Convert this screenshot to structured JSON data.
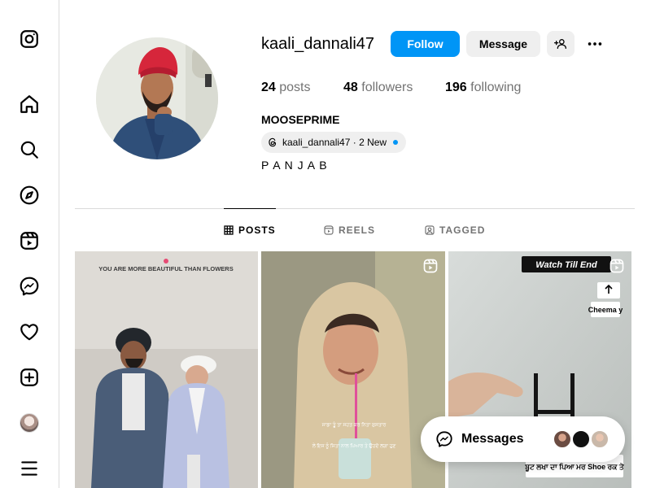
{
  "sidebar": {
    "items": [
      {
        "name": "instagram-logo-icon"
      },
      {
        "name": "home-icon"
      },
      {
        "name": "search-icon"
      },
      {
        "name": "explore-icon"
      },
      {
        "name": "reels-icon"
      },
      {
        "name": "messenger-icon"
      },
      {
        "name": "notifications-heart-icon"
      },
      {
        "name": "create-icon"
      },
      {
        "name": "profile-avatar"
      },
      {
        "name": "menu-icon"
      }
    ]
  },
  "profile": {
    "username": "kaali_dannali47",
    "follow_label": "Follow",
    "message_label": "Message",
    "stats": {
      "posts_count": "24",
      "posts_label": "posts",
      "followers_count": "48",
      "followers_label": "followers",
      "following_count": "196",
      "following_label": "following"
    },
    "full_name": "MOOSEPRIME",
    "threads_badge": "kaali_dannali47 · 2 New",
    "bio": "P A N J A B"
  },
  "tabs": [
    {
      "label": "POSTS",
      "active": true
    },
    {
      "label": "REELS",
      "active": false
    },
    {
      "label": "TAGGED",
      "active": false
    }
  ],
  "posts": [
    {
      "caption": "YOU ARE MORE BEAUTIFUL THAN FLOWERS",
      "is_reel": false
    },
    {
      "caption": "",
      "is_reel": true
    },
    {
      "caption": "Watch Till End",
      "sticker": "Cheema y",
      "bottom_text": "ਬੂਟ ਲਖਾ ਦਾ ਪਿਆ ਮਰ Shoe ਰਕ ਤੇ",
      "is_reel": true
    }
  ],
  "messages_bar": {
    "label": "Messages"
  },
  "colors": {
    "accent": "#0095f6",
    "button_gray": "#efefef",
    "border": "#dbdbdb",
    "muted_text": "#737373"
  }
}
